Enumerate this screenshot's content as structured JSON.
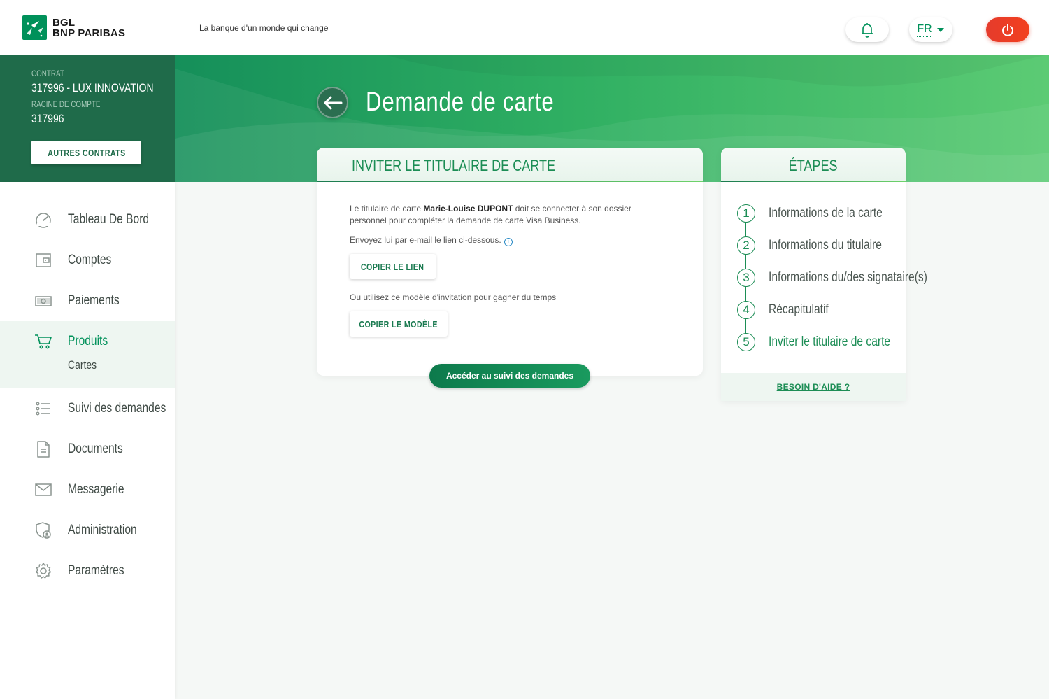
{
  "brand": {
    "line1": "BGL",
    "line2": "BNP PARIBAS",
    "tagline": "La banque d'un monde qui change"
  },
  "header": {
    "language": "FR"
  },
  "contract": {
    "contract_label": "CONTRAT",
    "contract_value": "317996 - LUX INNOVATION",
    "root_label": "RACINE DE COMPTE",
    "root_value": "317996",
    "other_contracts": "AUTRES CONTRATS"
  },
  "page": {
    "title": "Demande de carte"
  },
  "sidebar": {
    "items": [
      {
        "label": "Tableau De Bord",
        "icon": "dashboard-gauge-icon"
      },
      {
        "label": "Comptes",
        "icon": "wallet-icon"
      },
      {
        "label": "Paiements",
        "icon": "banknote-icon"
      },
      {
        "label": "Produits",
        "icon": "cart-icon"
      },
      {
        "label": "Suivi des demandes",
        "icon": "list-icon"
      },
      {
        "label": "Documents",
        "icon": "document-icon"
      },
      {
        "label": "Messagerie",
        "icon": "envelope-icon"
      },
      {
        "label": "Administration",
        "icon": "shield-user-icon"
      },
      {
        "label": "Paramètres",
        "icon": "gear-icon"
      }
    ],
    "sub_item": "Cartes"
  },
  "invite": {
    "title": "INVITER LE TITULAIRE DE CARTE",
    "text_prefix": "Le titulaire de carte ",
    "holder_name": "Marie-Louise DUPONT",
    "text_suffix": " doit se connecter à son dossier",
    "text_line2": "personnel pour compléter la demande de carte Visa Business.",
    "email_text": "Envoyez lui par e-mail le lien ci-dessous.",
    "copy_link": "COPIER LE LIEN",
    "template_text": "Ou utilisez ce modèle d'invitation pour gagner du temps",
    "copy_template": "COPIER LE MODÈLE",
    "track_button": "Accéder au suivi des demandes"
  },
  "steps": {
    "title": "ÉTAPES",
    "items": [
      {
        "num": "1",
        "label": "Informations de la carte"
      },
      {
        "num": "2",
        "label": "Informations du titulaire"
      },
      {
        "num": "3",
        "label": "Informations du/des signataire(s)"
      },
      {
        "num": "4",
        "label": "Récapitulatif"
      },
      {
        "num": "5",
        "label": "Inviter le titulaire de carte"
      }
    ],
    "active_step": 5,
    "help": "BESOIN D'AIDE ?"
  },
  "colors": {
    "brand_green": "#00915a",
    "dark_green": "#1f6b4a",
    "logout_red": "#e53b2c"
  }
}
